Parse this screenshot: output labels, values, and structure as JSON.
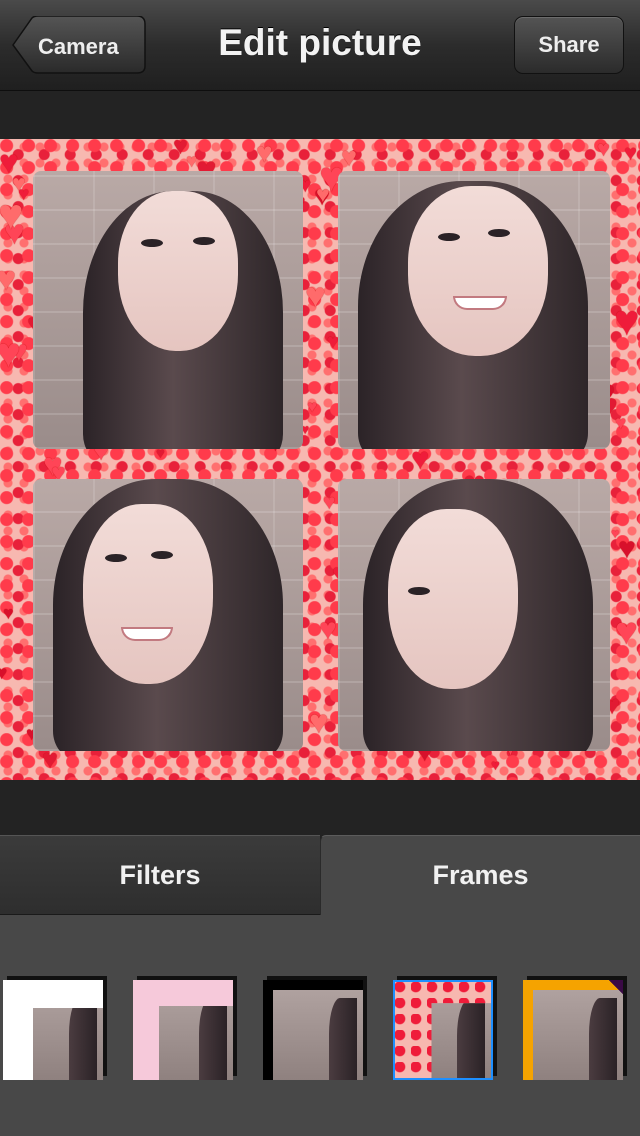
{
  "nav": {
    "back_label": "Camera",
    "title": "Edit picture",
    "share_label": "Share"
  },
  "tabs": [
    {
      "label": "Filters",
      "selected": false
    },
    {
      "label": "Frames",
      "selected": true
    }
  ],
  "frames": [
    {
      "name": "torn-paper-frame",
      "selected": false
    },
    {
      "name": "pink-floral-frame",
      "selected": false
    },
    {
      "name": "black-border-frame",
      "selected": false
    },
    {
      "name": "hearts-frame",
      "selected": true
    },
    {
      "name": "orange-stripe-frame",
      "selected": false
    }
  ],
  "colors": {
    "accent": "#1e8fff",
    "heart_red": "#ef1c3a",
    "tray": "#484848"
  }
}
